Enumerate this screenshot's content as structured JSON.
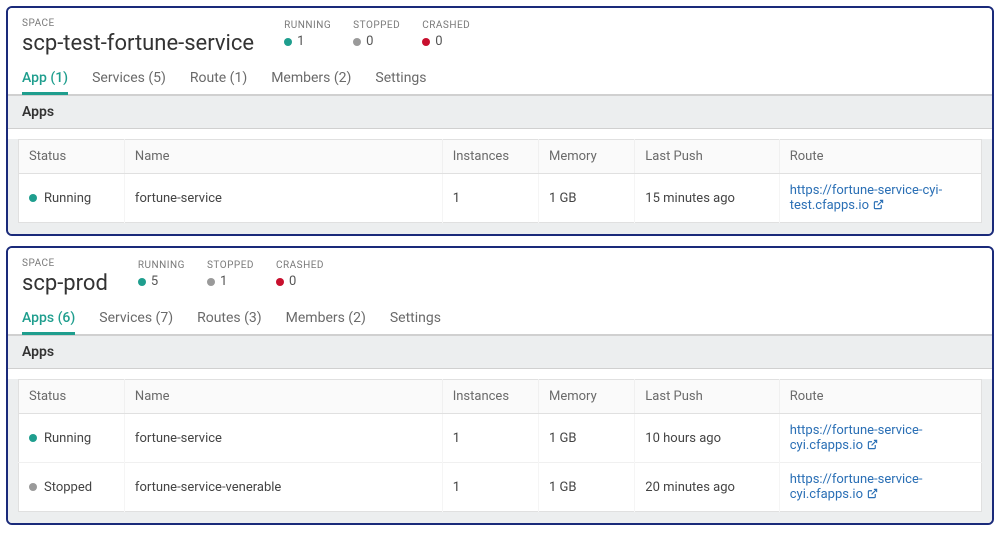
{
  "labels": {
    "space": "SPACE",
    "running": "RUNNING",
    "stopped": "STOPPED",
    "crashed": "CRASHED",
    "appsSection": "Apps",
    "cols": {
      "status": "Status",
      "name": "Name",
      "instances": "Instances",
      "memory": "Memory",
      "lastPush": "Last Push",
      "route": "Route"
    }
  },
  "spaces": [
    {
      "name": "scp-test-fortune-service",
      "stats": {
        "running": "1",
        "stopped": "0",
        "crashed": "0"
      },
      "tabs": [
        {
          "label": "App (1)",
          "active": true
        },
        {
          "label": "Services (5)",
          "active": false
        },
        {
          "label": "Route (1)",
          "active": false
        },
        {
          "label": "Members (2)",
          "active": false
        },
        {
          "label": "Settings",
          "active": false
        }
      ],
      "apps": [
        {
          "status": "Running",
          "statusDot": "green",
          "name": "fortune-service",
          "instances": "1",
          "memory": "1 GB",
          "lastPush": "15 minutes ago",
          "route": "https://fortune-service-cyi-test.cfapps.io"
        }
      ]
    },
    {
      "name": "scp-prod",
      "stats": {
        "running": "5",
        "stopped": "1",
        "crashed": "0"
      },
      "tabs": [
        {
          "label": "Apps (6)",
          "active": true
        },
        {
          "label": "Services (7)",
          "active": false
        },
        {
          "label": "Routes (3)",
          "active": false
        },
        {
          "label": "Members (2)",
          "active": false
        },
        {
          "label": "Settings",
          "active": false
        }
      ],
      "apps": [
        {
          "status": "Running",
          "statusDot": "green",
          "name": "fortune-service",
          "instances": "1",
          "memory": "1 GB",
          "lastPush": "10 hours ago",
          "route": "https://fortune-service-cyi.cfapps.io"
        },
        {
          "status": "Stopped",
          "statusDot": "grey",
          "name": "fortune-service-venerable",
          "instances": "1",
          "memory": "1 GB",
          "lastPush": "20 minutes ago",
          "route": "https://fortune-service-cyi.cfapps.io"
        }
      ]
    }
  ]
}
